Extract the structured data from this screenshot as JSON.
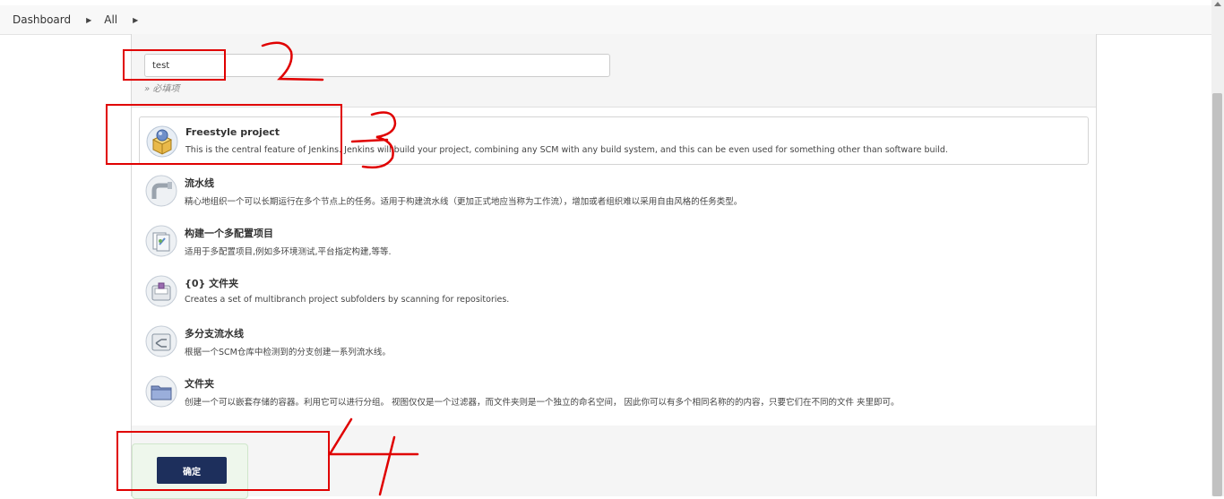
{
  "breadcrumb": {
    "items": [
      "Dashboard",
      "All"
    ]
  },
  "form": {
    "item_name_value": "test",
    "required_hint": "» 必填项"
  },
  "item_types": [
    {
      "title": "Freestyle project",
      "description": "This is the central feature of Jenkins. Jenkins will build your project, combining any SCM with any build system, and this can be even used for something other than software build.",
      "icon": "freestyle-project-icon"
    },
    {
      "title": "流水线",
      "description": "精心地组织一个可以长期运行在多个节点上的任务。适用于构建流水线（更加正式地应当称为工作流），增加或者组织难以采用自由风格的任务类型。",
      "icon": "pipeline-icon"
    },
    {
      "title": "构建一个多配置项目",
      "description": "适用于多配置项目,例如多环境测试,平台指定构建,等等.",
      "icon": "multi-config-project-icon"
    },
    {
      "title": "{0} 文件夹",
      "description": "Creates a set of multibranch project subfolders by scanning for repositories.",
      "icon": "organization-folder-icon"
    },
    {
      "title": "多分支流水线",
      "description": "根据一个SCM仓库中检测到的分支创建一系列流水线。",
      "icon": "multibranch-pipeline-icon"
    },
    {
      "title": "文件夹",
      "description": "创建一个可以嵌套存储的容器。利用它可以进行分组。 视图仅仅是一个过滤器，而文件夹则是一个独立的命名空间， 因此你可以有多个相同名称的的内容，只要它们在不同的文件 夹里即可。",
      "icon": "folder-icon"
    }
  ],
  "footer": {
    "ok_label": "确定"
  },
  "colors": {
    "annotation_red": "#e00000",
    "ok_button": "#1d2f5c"
  }
}
